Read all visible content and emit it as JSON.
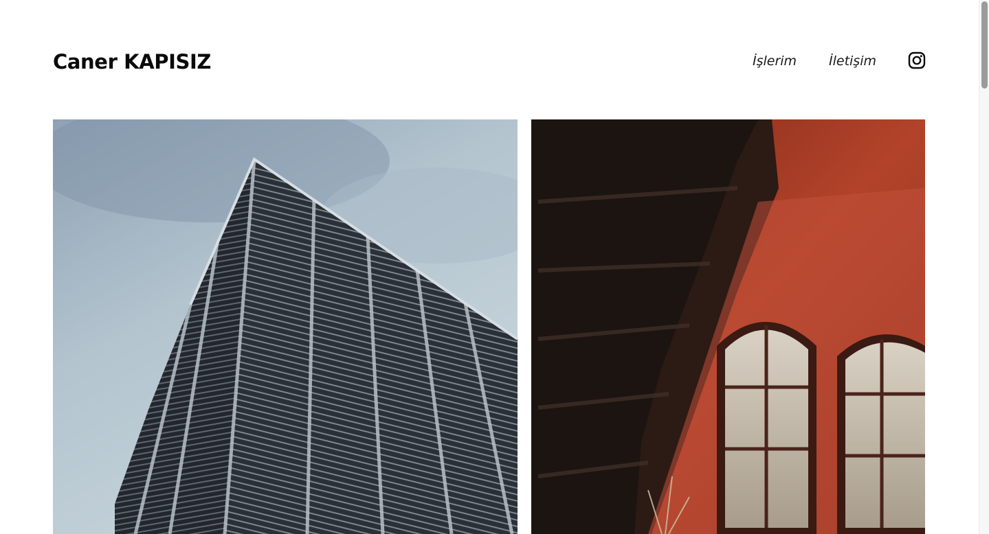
{
  "header": {
    "brand": "Caner KAPISIZ",
    "nav": [
      {
        "label": "İşlerim"
      },
      {
        "label": "İletişim"
      }
    ],
    "social_icon": "instagram-icon"
  },
  "gallery": [
    {
      "subject": "building-facade-photo"
    },
    {
      "subject": "stairwell-windows-photo"
    }
  ],
  "colors": {
    "text": "#0a0a0a",
    "background": "#ffffff"
  }
}
